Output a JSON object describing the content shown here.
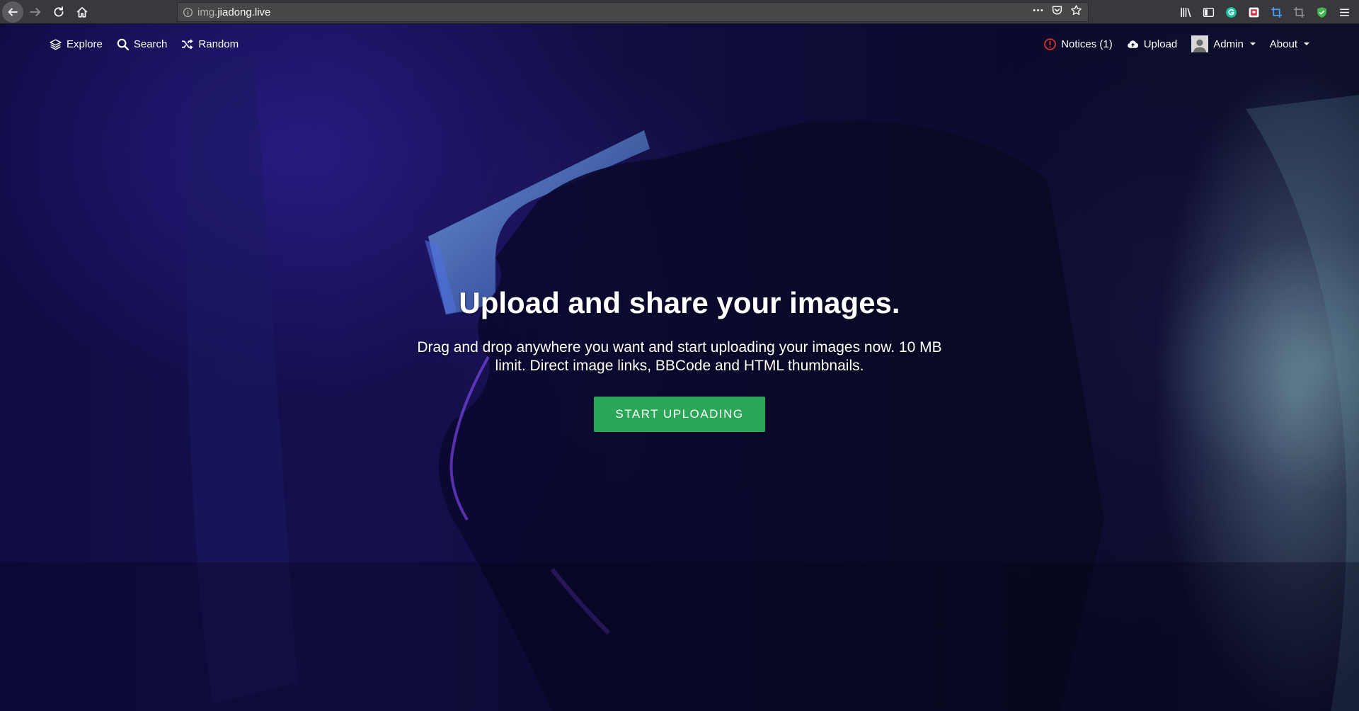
{
  "browser": {
    "url_prefix": "img.",
    "url_host": "jiadong.live",
    "icons": {
      "back": "back-arrow-icon",
      "forward": "forward-arrow-icon",
      "reload": "reload-icon",
      "home": "home-icon",
      "info": "info-icon",
      "more": "ellipsis-icon",
      "pocket": "pocket-icon",
      "bookmark": "star-icon",
      "library": "library-icon",
      "sidebar": "sidebar-icon",
      "grammarly": "grammarly-icon",
      "extension": "extension-icon",
      "screenshot": "crop-icon",
      "shield": "shield-icon",
      "menu": "hamburger-menu-icon"
    }
  },
  "nav": {
    "left": [
      {
        "label": "Explore",
        "icon": "layers-icon"
      },
      {
        "label": "Search",
        "icon": "search-icon"
      },
      {
        "label": "Random",
        "icon": "shuffle-icon"
      }
    ],
    "right": {
      "notices": "Notices (1)",
      "upload": "Upload",
      "admin": "Admin",
      "about": "About"
    }
  },
  "hero": {
    "title": "Upload and share your images.",
    "text": "Drag and drop anywhere you want and start uploading your images now. 10 MB limit. Direct image links, BBCode and HTML thumbnails.",
    "button": "START UPLOADING"
  },
  "colors": {
    "accent_button": "#2aa756",
    "notice_icon": "#e0322f",
    "chrome_bg": "#38383d"
  }
}
